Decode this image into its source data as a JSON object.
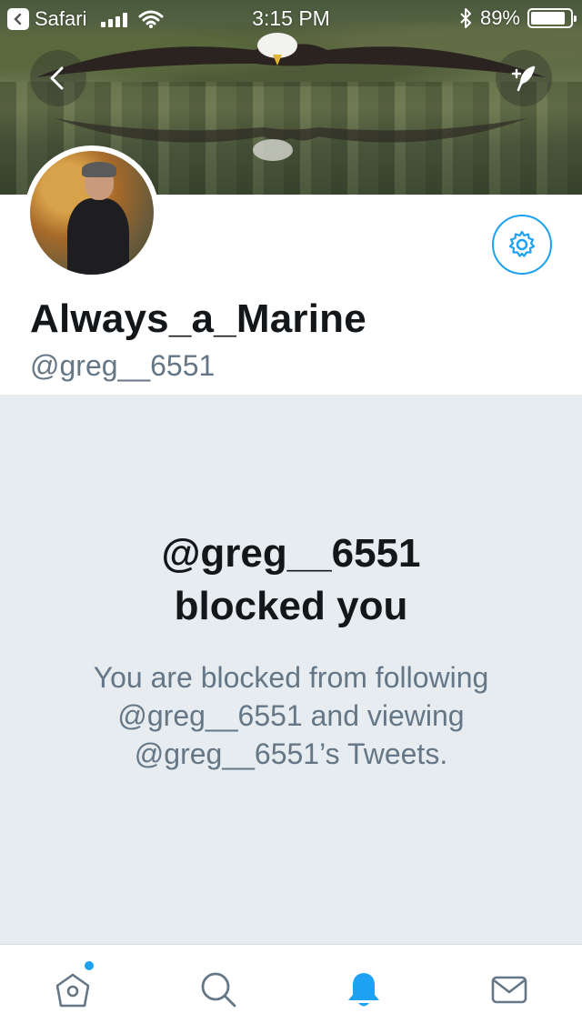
{
  "status_bar": {
    "back_app": "Safari",
    "time": "3:15 PM",
    "battery": "89%",
    "battery_level": 0.89
  },
  "profile": {
    "display_name": "Always_a_Marine",
    "handle": "@greg__6551"
  },
  "blocked": {
    "title_line1": "@greg__6551",
    "title_line2": "blocked you",
    "description": "You are blocked from following @greg__6551 and viewing @greg__6551’s Tweets."
  },
  "tabs": [
    {
      "icon": "home-icon",
      "has_dot": true
    },
    {
      "icon": "search-icon"
    },
    {
      "icon": "notifications-icon",
      "active": true
    },
    {
      "icon": "messages-icon"
    }
  ],
  "colors": {
    "accent": "#1da1f2",
    "text_primary": "#14171a",
    "text_secondary": "#657786",
    "panel_bg": "#e6ecf0"
  }
}
